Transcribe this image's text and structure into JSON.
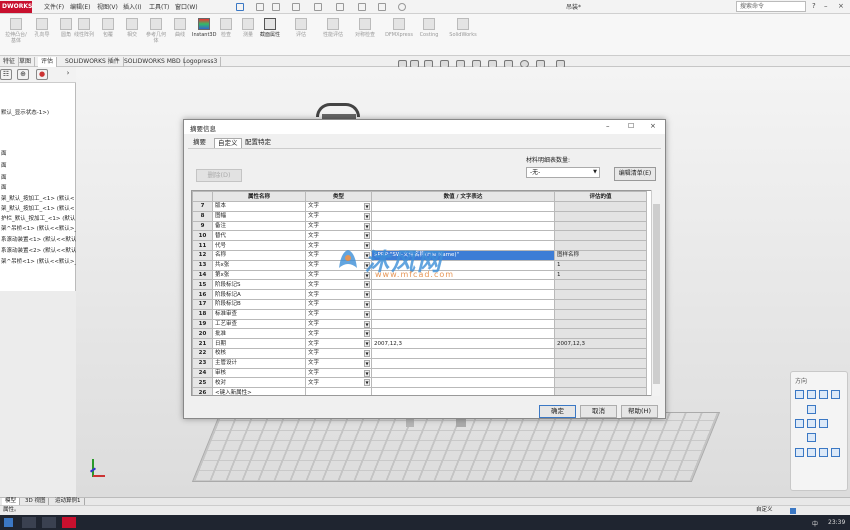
{
  "app": {
    "logo": "DWORKS",
    "menu": [
      "文件(F)",
      "编辑(E)",
      "视图(V)",
      "插入(I)",
      "工具(T)",
      "窗口(W)"
    ],
    "doc_title": "吊装*",
    "search_placeholder": "搜索命令"
  },
  "toolbar": {
    "buttons": [
      "拉伸凸台/基体",
      "孔向导",
      "圆角",
      "线性阵列",
      "包覆",
      "相交",
      "参考几何体",
      "曲线",
      "Instant3D",
      "检查",
      "测量",
      "截面属性",
      "评估",
      "性能评估",
      "对称检查",
      "DFMXpress",
      "Costing",
      "SolidWorks"
    ],
    "feature_tabs": [
      "特征",
      "草图",
      "评估",
      "SOLIDWORKS 插件",
      "SOLIDWORKS MBD",
      "Logopress3"
    ]
  },
  "feature_tree": {
    "items": [
      "默认_显示状态-1>)",
      "面",
      "面",
      "面",
      "面",
      "架_默认_按加工_<1> (默认<",
      "架_默认_按加工_<1> (默认<",
      "护栏_默认_按加工_<1> (默认",
      "架^吊桥<1> (默认<<默认>_显",
      "系滚动装置<1> (默认<<默认>",
      "系滚动装置<2> (默认<<默认>",
      "架^吊桥<1> (默认<<默认>_显"
    ]
  },
  "dialog": {
    "title": "摘要信息",
    "tabs": [
      "摘要",
      "自定义",
      "配置特定"
    ],
    "delete_label": "删除(D)",
    "bom_qty_label": "材料明细表数量:",
    "bom_qty_value": "-无-",
    "edit_list_label": "编辑清单(E)",
    "columns": [
      "",
      "属性名称",
      "类型",
      "数值 / 文字表达",
      "评估的值"
    ],
    "rows": [
      {
        "n": "7",
        "name": "版本",
        "type": "文字",
        "value": "",
        "eval": ""
      },
      {
        "n": "8",
        "name": "图幅",
        "type": "文字",
        "value": "",
        "eval": ""
      },
      {
        "n": "9",
        "name": "备注",
        "type": "文字",
        "value": "",
        "eval": ""
      },
      {
        "n": "10",
        "name": "替代",
        "type": "文字",
        "value": "",
        "eval": ""
      },
      {
        "n": "11",
        "name": "代号",
        "type": "文字",
        "value": "",
        "eval": ""
      },
      {
        "n": "12",
        "name": "名称",
        "type": "文字",
        "value": "$PRP:\"SW-文件名称(File Name)\"",
        "eval": "图样名称"
      },
      {
        "n": "13",
        "name": "共x张",
        "type": "文字",
        "value": "",
        "eval": "1"
      },
      {
        "n": "14",
        "name": "第x张",
        "type": "文字",
        "value": "",
        "eval": "1"
      },
      {
        "n": "15",
        "name": "阶段标记S",
        "type": "文字",
        "value": "",
        "eval": ""
      },
      {
        "n": "16",
        "name": "阶段标记A",
        "type": "文字",
        "value": "",
        "eval": ""
      },
      {
        "n": "17",
        "name": "阶段标记B",
        "type": "文字",
        "value": "",
        "eval": ""
      },
      {
        "n": "18",
        "name": "标准审查",
        "type": "文字",
        "value": "",
        "eval": ""
      },
      {
        "n": "19",
        "name": "工艺审查",
        "type": "文字",
        "value": "",
        "eval": ""
      },
      {
        "n": "20",
        "name": "批准",
        "type": "文字",
        "value": "",
        "eval": ""
      },
      {
        "n": "21",
        "name": "日期",
        "type": "文字",
        "value": "2007,12,3",
        "eval": "2007,12,3"
      },
      {
        "n": "22",
        "name": "校核",
        "type": "文字",
        "value": "",
        "eval": ""
      },
      {
        "n": "23",
        "name": "主管设计",
        "type": "文字",
        "value": "",
        "eval": ""
      },
      {
        "n": "24",
        "name": "审核",
        "type": "文字",
        "value": "",
        "eval": ""
      },
      {
        "n": "25",
        "name": "校对",
        "type": "文字",
        "value": "",
        "eval": ""
      },
      {
        "n": "26",
        "name": "<键入新属性>",
        "type": "",
        "value": "",
        "eval": ""
      }
    ],
    "ok_label": "确定",
    "cancel_label": "取消",
    "help_label": "帮助(H)"
  },
  "bottom_tabs": [
    "模型",
    "3D 视图",
    "运动算例1"
  ],
  "status": {
    "left": "属性。",
    "right": "自定义"
  },
  "orientation_panel_title": "方向",
  "taskbar": {
    "ime": "中",
    "time": "23:39"
  },
  "watermark": {
    "text": "沐风网",
    "url": "www.mfcad.com"
  },
  "colors": {
    "accent": "#3b78c4",
    "brand_red": "#c8102e",
    "selection": "#3d7dd6"
  }
}
